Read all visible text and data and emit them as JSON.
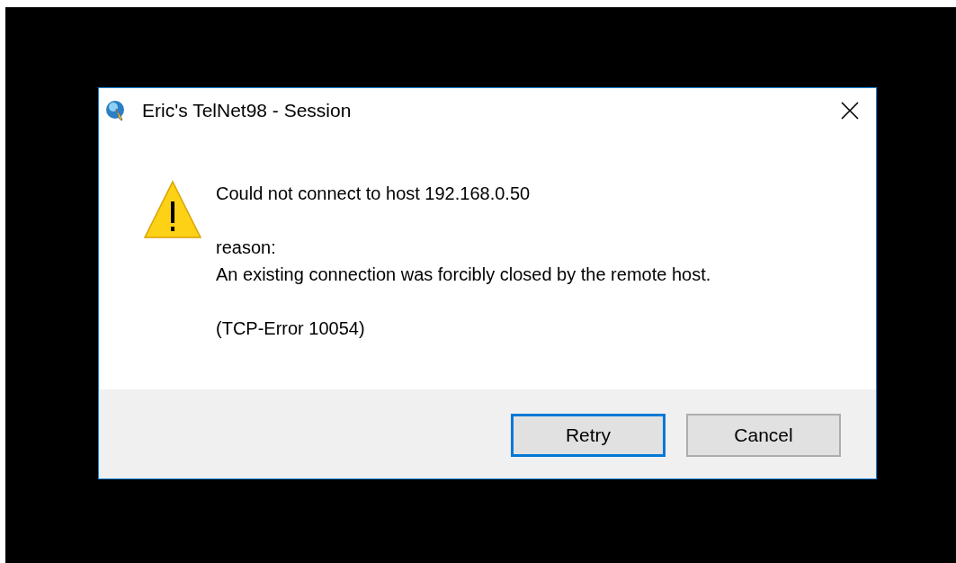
{
  "window": {
    "title": "Eric's TelNet98 - Session"
  },
  "message": {
    "lines": [
      {
        "text": "Could not connect to host 192.168.0.50"
      },
      {
        "text": "reason:"
      },
      {
        "text": "An existing connection was forcibly closed by the remote host."
      },
      {
        "text": "(TCP-Error 10054)"
      }
    ]
  },
  "buttons": [
    {
      "label": "Retry",
      "focused": true
    },
    {
      "label": "Cancel",
      "focused": false
    }
  ]
}
